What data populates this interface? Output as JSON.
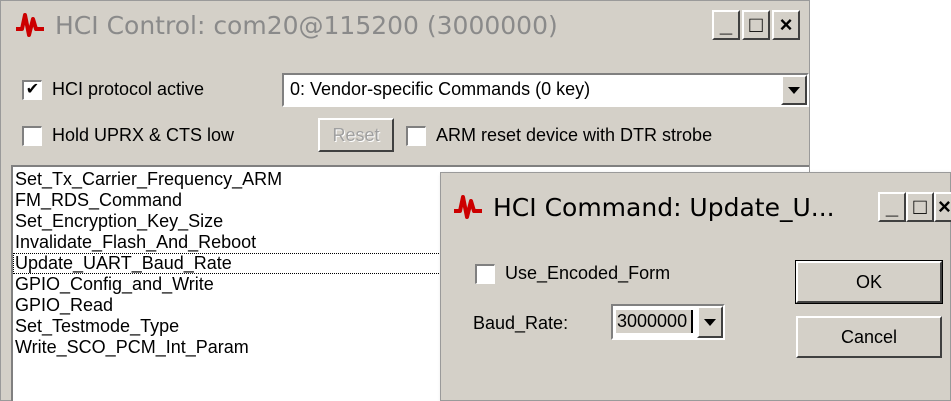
{
  "main_window": {
    "title": "HCI Control: com20@115200 (3000000)",
    "caption_buttons": [
      "_",
      "□",
      "×"
    ],
    "hci_protocol_active": {
      "label": "HCI protocol active",
      "checked": true
    },
    "command_combo": {
      "value": "0: Vendor-specific Commands (0 key)"
    },
    "hold_uprx": {
      "label": "Hold UPRX & CTS low",
      "checked": false
    },
    "reset_button": {
      "label": "Reset"
    },
    "arm_reset": {
      "label": "ARM reset device with DTR strobe",
      "checked": false
    },
    "commands": [
      "Set_Tx_Carrier_Frequency_ARM",
      "FM_RDS_Command",
      "Set_Encryption_Key_Size",
      "Invalidate_Flash_And_Reboot",
      "Update_UART_Baud_Rate",
      "GPIO_Config_and_Write",
      "GPIO_Read",
      "Set_Testmode_Type",
      "Write_SCO_PCM_Int_Param"
    ],
    "selected_index": 4
  },
  "dialog": {
    "title": "HCI Command: Update_U...",
    "caption_buttons": [
      "_",
      "□",
      "×"
    ],
    "use_encoded_form": {
      "label": "Use_Encoded_Form",
      "checked": false
    },
    "baud_rate": {
      "label": "Baud_Rate:",
      "value": "3000000"
    },
    "ok_label": "OK",
    "cancel_label": "Cancel"
  },
  "icons": {
    "app": "waveform-icon",
    "accent": "#cc0000"
  }
}
